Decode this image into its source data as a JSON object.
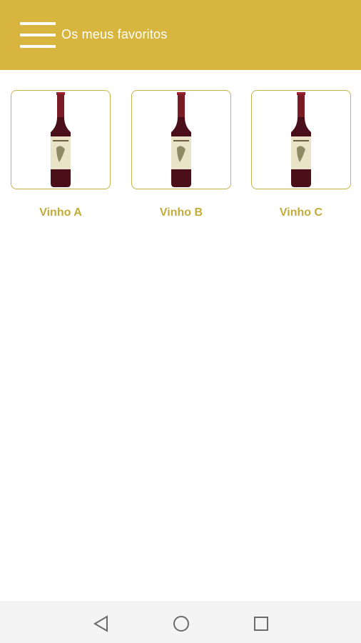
{
  "header": {
    "title": "Os meus favoritos",
    "menu_icon": "hamburger-menu-icon",
    "background_color": "#d8b53f"
  },
  "favorites": {
    "items": [
      {
        "name": "Vinho A",
        "image_icon": "wine-bottle-icon"
      },
      {
        "name": "Vinho B",
        "image_icon": "wine-bottle-icon"
      },
      {
        "name": "Vinho C",
        "image_icon": "wine-bottle-icon"
      }
    ],
    "label_color": "#c2ab37",
    "border_color": "#c6b24a"
  },
  "system_nav": {
    "back_icon": "back-triangle-icon",
    "home_icon": "home-circle-icon",
    "recent_icon": "recent-apps-square-icon"
  }
}
